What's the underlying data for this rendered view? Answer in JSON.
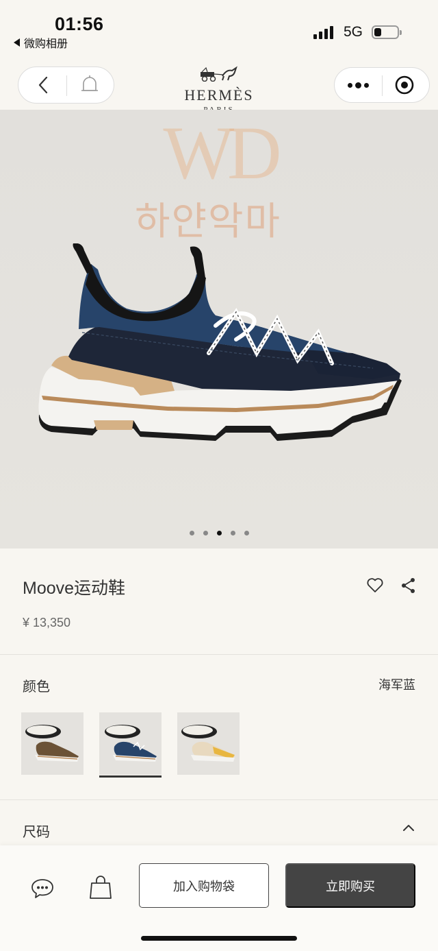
{
  "status_bar": {
    "time": "01:56",
    "back_app": "微购相册",
    "network": "5G"
  },
  "nav": {
    "back_icon": "chevron-left-icon",
    "bell_icon": "bell-icon",
    "more_icon": "more-dots-icon",
    "scan_icon": "target-icon"
  },
  "logo": {
    "brand": "HERMÈS",
    "city": "PARIS"
  },
  "watermark": {
    "letters": "WD",
    "text": "하얀악마"
  },
  "carousel": {
    "count": 5,
    "active_index": 2
  },
  "product": {
    "title": "Moove运动鞋",
    "price": "¥ 13,350"
  },
  "color": {
    "label": "颜色",
    "value": "海军蓝",
    "swatches": [
      "brown",
      "navy",
      "yellow"
    ],
    "selected_index": 1
  },
  "size": {
    "label": "尺码"
  },
  "bottom": {
    "add_to_bag": "加入购物袋",
    "buy_now": "立即购买"
  },
  "colors": {
    "accent": "#444444",
    "background": "#f8f6f1",
    "navy": "#1e2f4d",
    "tan": "#d8b58a"
  }
}
